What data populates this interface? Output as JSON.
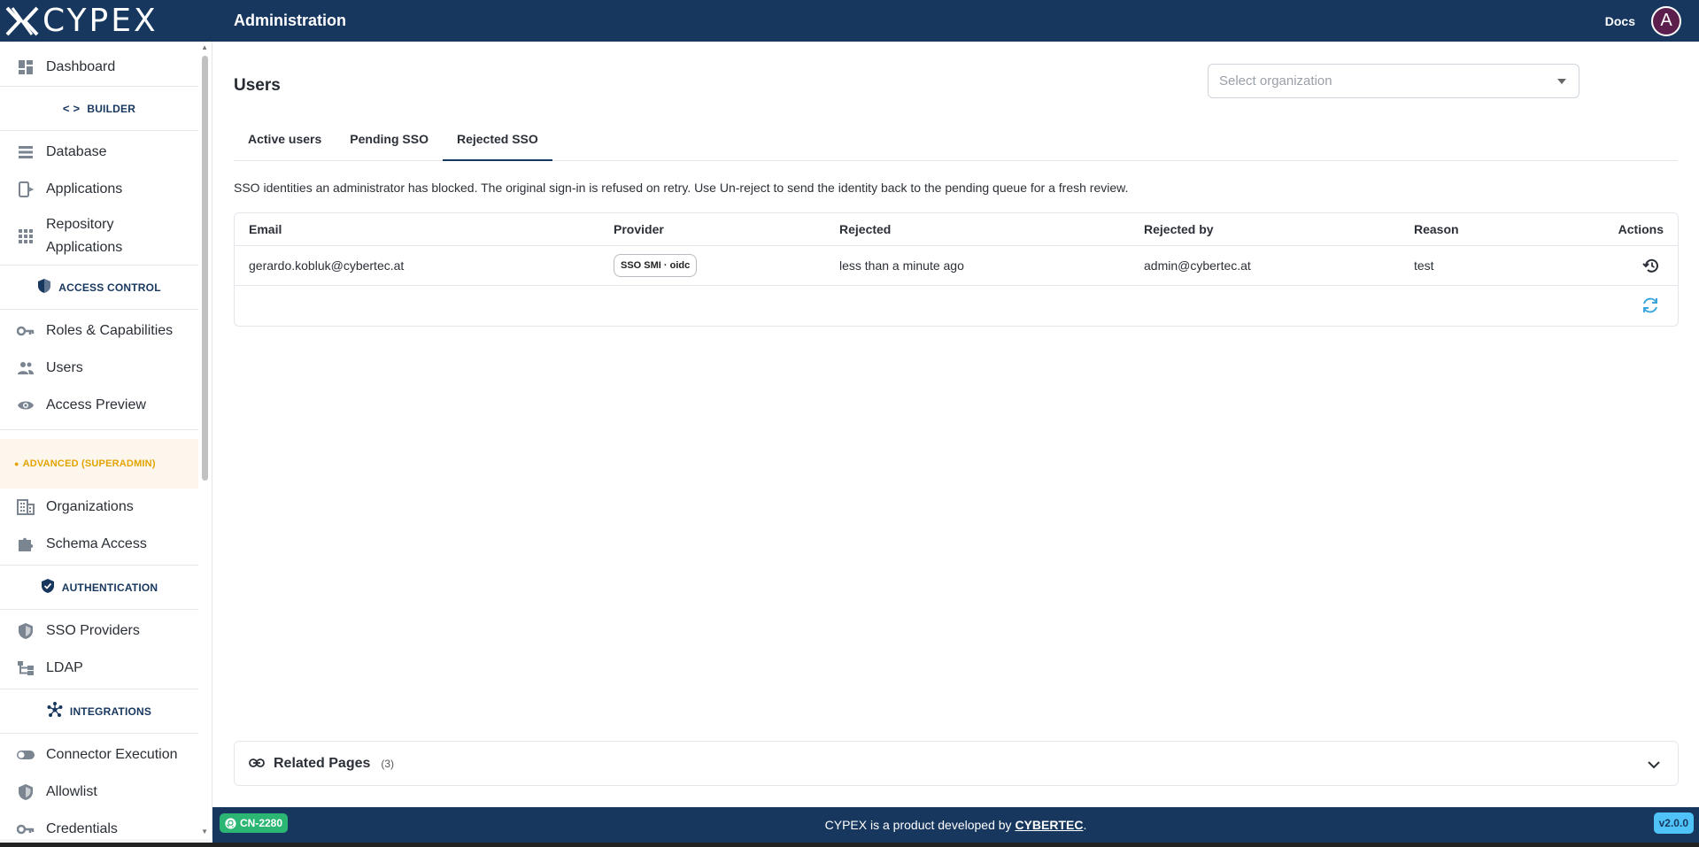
{
  "header": {
    "logo_text": "CYPEX",
    "title": "Administration",
    "docs_label": "Docs",
    "avatar_letter": "A"
  },
  "sidebar": {
    "dashboard": "Dashboard",
    "builder_section": "BUILDER",
    "database": "Database",
    "applications": "Applications",
    "repository_line1": "Repository",
    "repository_line2": "Applications",
    "access_control_section": "ACCESS CONTROL",
    "roles": "Roles & Capabilities",
    "users": "Users",
    "access_preview": "Access Preview",
    "advanced_section": "ADVANCED (SUPERADMIN)",
    "organizations": "Organizations",
    "schema_access": "Schema Access",
    "authentication_section": "AUTHENTICATION",
    "sso_providers": "SSO Providers",
    "ldap": "LDAP",
    "integrations_section": "INTEGRATIONS",
    "connector_execution": "Connector Execution",
    "allowlist": "Allowlist",
    "credentials": "Credentials"
  },
  "main": {
    "title": "Users",
    "org_placeholder": "Select organization",
    "tabs": [
      "Active users",
      "Pending SSO",
      "Rejected SSO"
    ],
    "description": "SSO identities an administrator has blocked. The original sign-in is refused on retry. Use Un-reject to send the identity back to the pending queue for a fresh review.",
    "table": {
      "headers": [
        "Email",
        "Provider",
        "Rejected",
        "Rejected by",
        "Reason",
        "Actions"
      ],
      "rows": [
        {
          "email": "gerardo.kobluk@cybertec.at",
          "provider": "SSO SMI · oidc",
          "rejected": "less than a minute ago",
          "rejected_by": "admin@cybertec.at",
          "reason": "test"
        }
      ]
    },
    "related": {
      "title": "Related Pages",
      "count": "(3)"
    }
  },
  "footer": {
    "ticket": "CN-2280",
    "text_prefix": "CYPEX is a product developed by ",
    "brand": "CYBERTEC",
    "suffix": ".",
    "version": "v2.0.0"
  },
  "colors": {
    "navy": "#17375e",
    "accent_blue": "#4fc3f7",
    "advanced_orange": "#e3a300",
    "ticket_green": "#2bb673"
  }
}
